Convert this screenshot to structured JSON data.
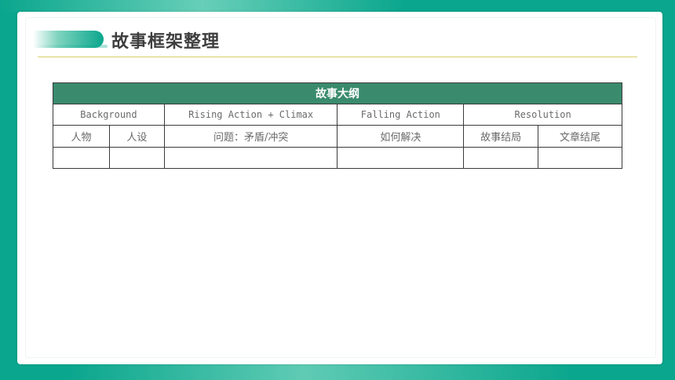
{
  "title": "故事框架整理",
  "colors": {
    "background": "#0aa68d",
    "table_header": "#3a8b6e",
    "title_underline": "#d8cf6a"
  },
  "table": {
    "header": "故事大纲",
    "sections": [
      "Background",
      "Rising Action + Climax",
      "Falling Action",
      "Resolution"
    ],
    "subheaders": [
      "人物",
      "人设",
      "问题：矛盾/冲突",
      "如何解决",
      "故事结局",
      "文章结尾"
    ],
    "empty_row": [
      "",
      "",
      "",
      "",
      "",
      ""
    ]
  }
}
